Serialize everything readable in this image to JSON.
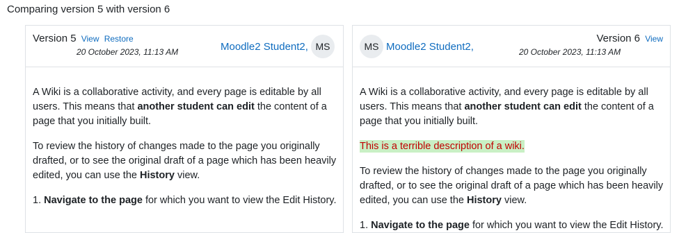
{
  "heading": "Comparing version 5 with version 6",
  "left": {
    "version_label": "Version 5",
    "view_link": "View",
    "restore_link": "Restore",
    "date": "20 October 2023, 11:13 AM",
    "user_name": "Moodle2 Student2,",
    "avatar_initials": "MS",
    "para1_a": "A Wiki is a collaborative activity, and every page is editable by all users. This means that ",
    "para1_b": "another student can edit",
    "para1_c": " the content of a page that you initially built.",
    "para2_a": "To review the history of changes made to the page you originally drafted, or to see the original draft of a page which has been heavily edited, you can use the ",
    "para2_b": "History",
    "para2_c": " view.",
    "para3_a": "1. ",
    "para3_b": "Navigate to the page",
    "para3_c": " for which you want to view the Edit History."
  },
  "right": {
    "version_label": "Version 6",
    "view_link": "View",
    "date": "20 October 2023, 11:13 AM",
    "user_name": "Moodle2 Student2,",
    "avatar_initials": "MS",
    "para1_a": "A Wiki is a collaborative activity, and every page is editable by all users. This means that ",
    "para1_b": "another student can edit",
    "para1_c": " the content of a page that you initially built.",
    "inserted": "This is a terrible description of a wiki.",
    "para2_a": "To review the history of changes made to the page you originally drafted, or to see the original draft of a page which has been heavily edited, you can use the ",
    "para2_b": "History",
    "para2_c": " view.",
    "para3_a": "1. ",
    "para3_b": "Navigate to the page",
    "para3_c": " for which you want to view the Edit History."
  },
  "colors": {
    "link": "#0f6cbf",
    "inserted_bg": "#c9f0c5",
    "inserted_text": "#c00000",
    "border": "#dee2e6"
  }
}
